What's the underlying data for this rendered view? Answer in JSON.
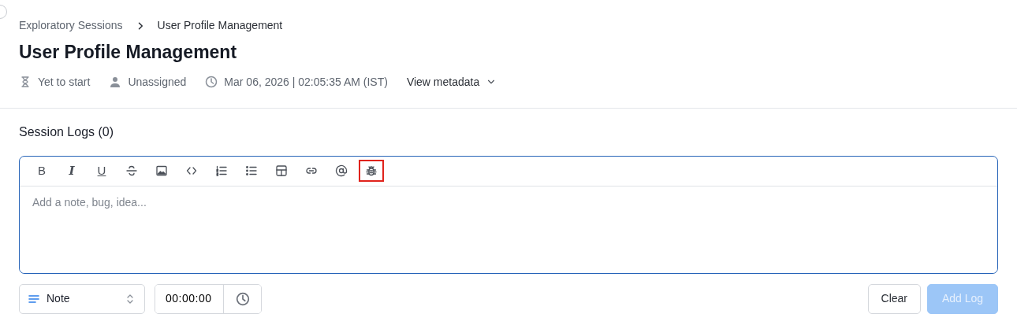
{
  "breadcrumb": [
    {
      "label": "Exploratory Sessions",
      "kind": "link"
    },
    {
      "label": "User Profile Management",
      "kind": "current"
    }
  ],
  "title": "User Profile Management",
  "meta": [
    {
      "kind": "status",
      "text": "Yet to start"
    },
    {
      "kind": "assignee",
      "text": "Unassigned"
    },
    {
      "kind": "time",
      "text": "Mar 06, 2026 | 02:05:35 AM (IST)"
    }
  ],
  "metadata_toggle": {
    "label": "View metadata",
    "expanded": false
  },
  "section_title": "Session Logs (0)",
  "toolbar": [
    {
      "kind": "bold",
      "label": "B",
      "highlighted": false
    },
    {
      "kind": "italic",
      "label": "I",
      "highlighted": false
    },
    {
      "kind": "underline",
      "label": "U",
      "highlighted": false
    },
    {
      "kind": "strike",
      "highlighted": false
    },
    {
      "kind": "image",
      "highlighted": false
    },
    {
      "kind": "code",
      "highlighted": false
    },
    {
      "kind": "ordered-list",
      "highlighted": false
    },
    {
      "kind": "bullet-list",
      "highlighted": false
    },
    {
      "kind": "table",
      "highlighted": false
    },
    {
      "kind": "link",
      "highlighted": false
    },
    {
      "kind": "mention",
      "highlighted": false
    },
    {
      "kind": "bug",
      "highlighted": true
    }
  ],
  "editor": {
    "placeholder": "Add a note, bug, idea..."
  },
  "log_type": {
    "value": "Note"
  },
  "time_input": {
    "value": "00:00:00"
  },
  "buttons": [
    {
      "label": "Clear",
      "kind": "secondary",
      "disabled": false
    },
    {
      "label": "Add Log",
      "kind": "primary",
      "disabled": true
    }
  ]
}
